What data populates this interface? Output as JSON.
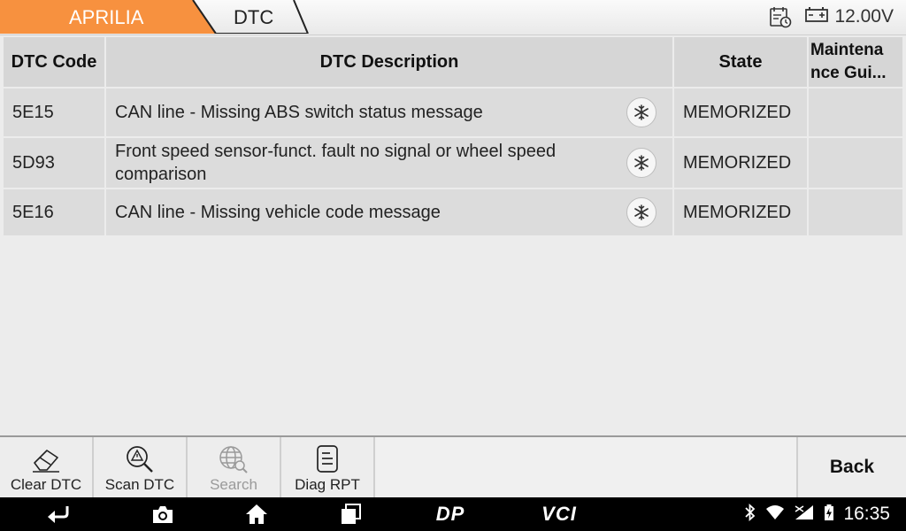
{
  "header": {
    "breadcrumbs": [
      "APRILIA",
      "DTC"
    ],
    "voltage": "12.00V",
    "colors": {
      "brand_tab": "#f7913f"
    }
  },
  "table": {
    "columns": [
      "DTC Code",
      "DTC Description",
      "State",
      "Maintena nce Gui..."
    ],
    "rows": [
      {
        "code": "5E15",
        "description": "CAN line - Missing ABS switch status message",
        "state": "MEMORIZED",
        "guide": "",
        "icon": "snowflake-icon"
      },
      {
        "code": "5D93",
        "description": "Front speed sensor-funct. fault no signal or wheel speed comparison",
        "state": "MEMORIZED",
        "guide": "",
        "icon": "snowflake-icon"
      },
      {
        "code": "5E16",
        "description": "CAN line - Missing vehicle code message",
        "state": "MEMORIZED",
        "guide": "",
        "icon": "snowflake-icon"
      }
    ]
  },
  "toolbar": {
    "clear_dtc": "Clear DTC",
    "scan_dtc": "Scan DTC",
    "search": "Search",
    "diag_rpt": "Diag RPT",
    "back": "Back"
  },
  "navbar": {
    "dp_label": "DP",
    "vci_label": "VCI",
    "time": "16:35"
  }
}
